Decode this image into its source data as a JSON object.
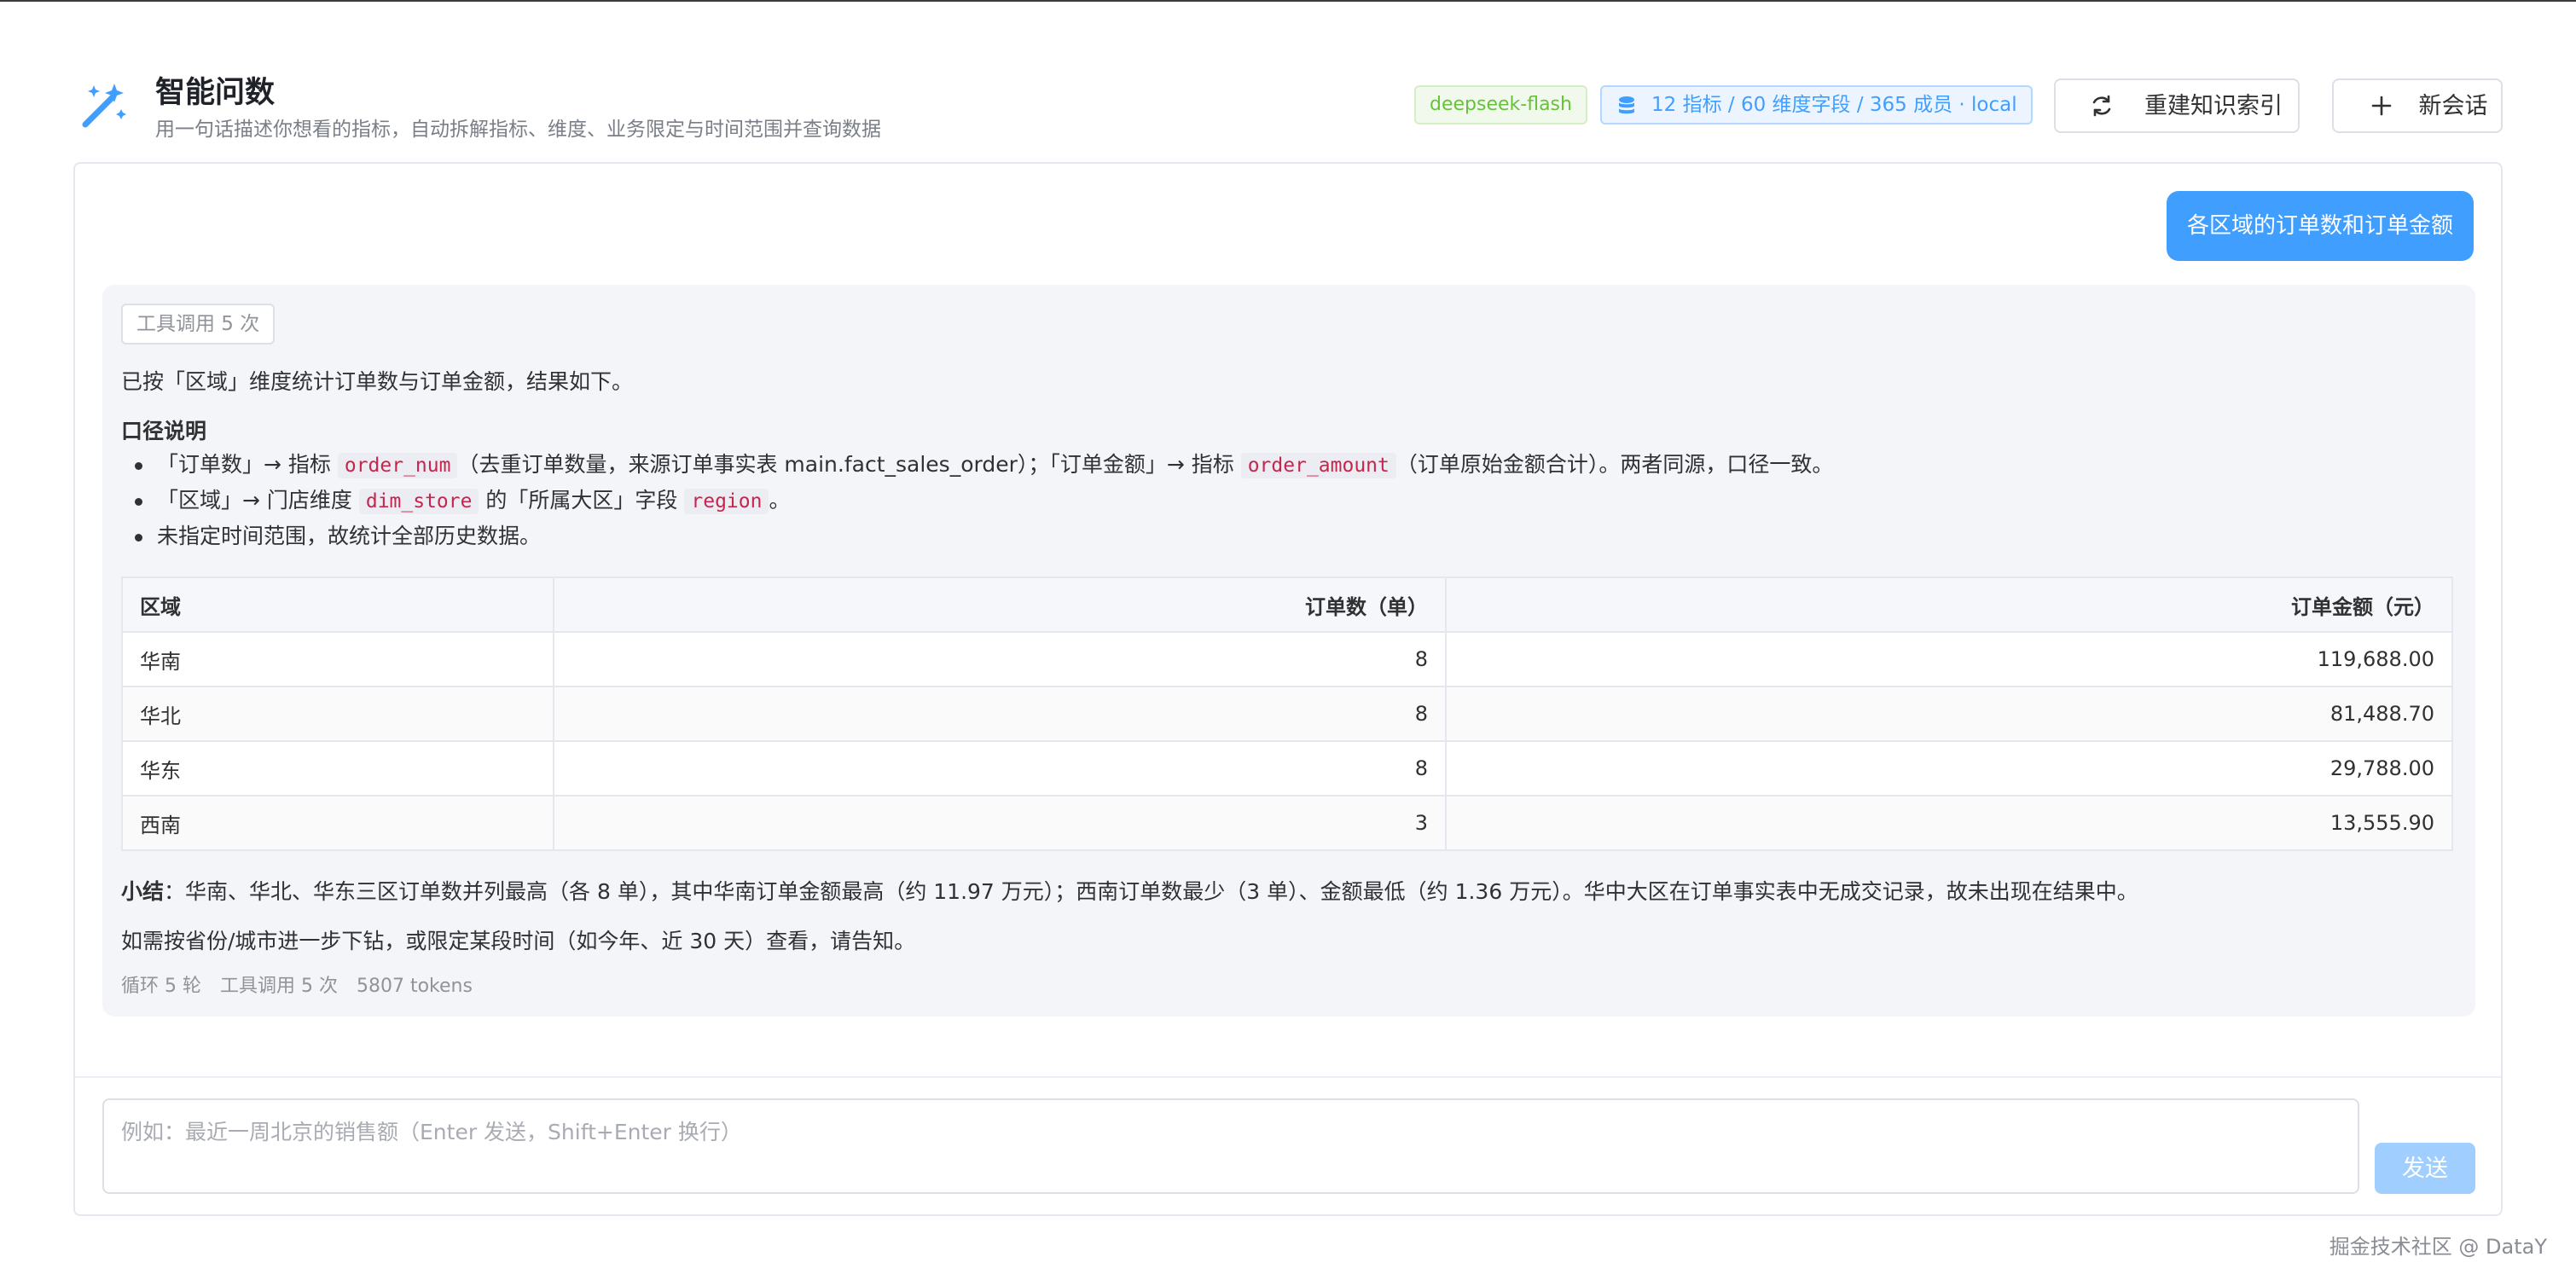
{
  "header": {
    "title": "智能问数",
    "subtitle": "用一句话描述你想看的指标，自动拆解指标、维度、业务限定与时间范围并查询数据",
    "model_tag": "deepseek-flash",
    "kb_tag": "12 指标 / 60 维度字段 / 365 成员 · local",
    "rebuild_label": "重建知识索引",
    "new_chat_label": "新会话"
  },
  "conversation": {
    "user_message": "各区域的订单数和订单金额",
    "reply": {
      "tool_chip": "工具调用 5 次",
      "intro": "已按「区域」维度统计订单数与订单金额，结果如下。",
      "section_title": "口径说明",
      "bullets": [
        {
          "t1": "「订单数」→ 指标 ",
          "c1": "order_num",
          "t2": "（去重订单数量，来源订单事实表 main.fact_sales_order）；「订单金额」→ 指标 ",
          "c2": "order_amount",
          "t3": "（订单原始金额合计）。两者同源，口径一致。"
        },
        {
          "t1": "「区域」→ 门店维度 ",
          "c1": "dim_store",
          "t2": " 的「所属大区」字段 ",
          "c2": "region",
          "t3": "。"
        },
        {
          "t1": "未指定时间范围，故统计全部历史数据。"
        }
      ],
      "table": {
        "headers": [
          "区域",
          "订单数（单）",
          "订单金额（元）"
        ],
        "rows": [
          [
            "华南",
            "8",
            "119,688.00"
          ],
          [
            "华北",
            "8",
            "81,488.70"
          ],
          [
            "华东",
            "8",
            "29,788.00"
          ],
          [
            "西南",
            "3",
            "13,555.90"
          ]
        ]
      },
      "summary_label": "小结",
      "summary_text": "：华南、华北、华东三区订单数并列最高（各 8 单），其中华南订单金额最高（约 11.97 万元）；西南订单数最少（3 单）、金额最低（约 1.36 万元）。华中大区在订单事实表中无成交记录，故未出现在结果中。",
      "followup": "如需按省份/城市进一步下钻，或限定某段时间（如今年、近 30 天）查看，请告知。",
      "stats": [
        "循环 5 轮",
        "工具调用 5 次",
        "5807 tokens"
      ]
    }
  },
  "input": {
    "placeholder": "例如：最近一周北京的销售额（Enter 发送，Shift+Enter 换行）",
    "send_label": "发送"
  },
  "watermark": "掘金技术社区 @ DataY",
  "colors": {
    "primary": "#409eff",
    "success": "#67c23a",
    "code": "#c7254e",
    "send_disabled": "#a0cfff"
  }
}
